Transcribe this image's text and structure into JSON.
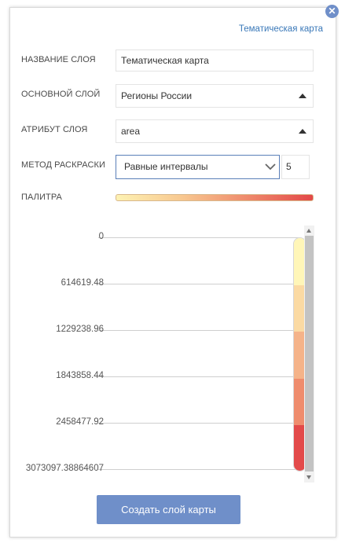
{
  "panel": {
    "title": "Тематическая карта"
  },
  "form": {
    "layer_name_label": "НАЗВАНИЕ СЛОЯ",
    "layer_name_value": "Тематическая карта",
    "base_layer_label": "ОСНОВНОЙ СЛОЙ",
    "base_layer_value": "Регионы России",
    "attribute_label": "АТРИБУТ СЛОЯ",
    "attribute_value": "area",
    "method_label": "МЕТОД РАСКРАСКИ",
    "method_value": "Равные интервалы",
    "class_count": "5",
    "palette_label": "ПАЛИТРА"
  },
  "palette": {
    "colors": [
      "#fdf2b3",
      "#f8c890",
      "#ef8a6c",
      "#e34848"
    ]
  },
  "legend": {
    "breaks": [
      "0",
      "614619.48",
      "1229238.96",
      "1843858.44",
      "2458477.92",
      "3073097.38864607"
    ],
    "class_colors": [
      "#fff6b8",
      "#fbdaa3",
      "#f5b389",
      "#ef8c6d",
      "#e34a4a"
    ]
  },
  "actions": {
    "create_label": "Создать слой карты"
  }
}
